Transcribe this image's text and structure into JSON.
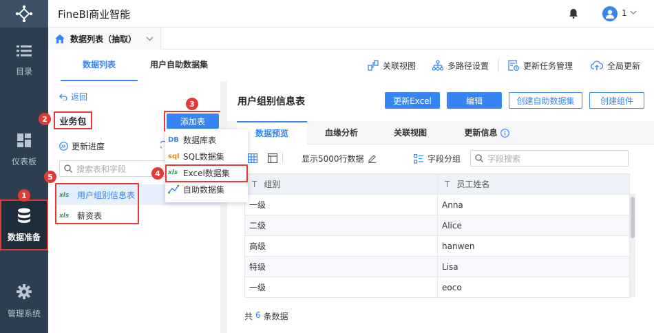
{
  "app": {
    "title": "FineBI商业智能",
    "user": "1"
  },
  "nav": [
    {
      "label": "目录"
    },
    {
      "label": "仪表板"
    },
    {
      "label": "数据准备"
    },
    {
      "label": "管理系统"
    }
  ],
  "tab": {
    "label": "数据列表（抽取）"
  },
  "subtabs": {
    "data_list": "数据列表",
    "self_dataset": "用户自助数据集"
  },
  "toolbar": {
    "relation_view": "关联视图",
    "multipath": "多路径设置",
    "update_task": "更新任务管理",
    "global_update": "全局更新"
  },
  "left": {
    "back": "返回",
    "package": "业务包",
    "add_table": "添加表",
    "update_progress": "更新进度",
    "search_placeholder": "搜索表和字段",
    "tables": [
      {
        "icon": "xls",
        "name": "用户组别信息表"
      },
      {
        "icon": "xls",
        "name": "薪资表"
      }
    ]
  },
  "menu": [
    {
      "icon": "DB",
      "label": "数据库表"
    },
    {
      "icon": "sql",
      "label": "SQL数据集"
    },
    {
      "icon": "xls",
      "label": "Excel数据集"
    },
    {
      "icon": "self",
      "label": "自助数据集"
    }
  ],
  "right": {
    "title": "用户组别信息表",
    "buttons": {
      "update_excel": "更新Excel",
      "edit": "编辑",
      "create_self": "创建自助数据集",
      "create_component": "创建组件"
    },
    "tabs": [
      "数据预览",
      "血缘分析",
      "关联视图",
      "更新信息"
    ],
    "show_rows": "显示5000行数据",
    "field_group": "字段分组",
    "field_search_placeholder": "字段搜索",
    "columns": [
      "组别",
      "员工姓名"
    ],
    "rows": [
      [
        "一级",
        "Anna"
      ],
      [
        "二级",
        "Alice"
      ],
      [
        "高级",
        "hanwen"
      ],
      [
        "特级",
        "Lisa"
      ],
      [
        "一级",
        "eoco"
      ]
    ],
    "total_prefix": "共",
    "total_count": "6",
    "total_suffix": "条数据"
  },
  "badges": [
    "1",
    "2",
    "3",
    "4",
    "5"
  ],
  "colors": {
    "accent": "#3685f2",
    "nav_bg": "#2c3e50",
    "highlight": "#e53935"
  }
}
